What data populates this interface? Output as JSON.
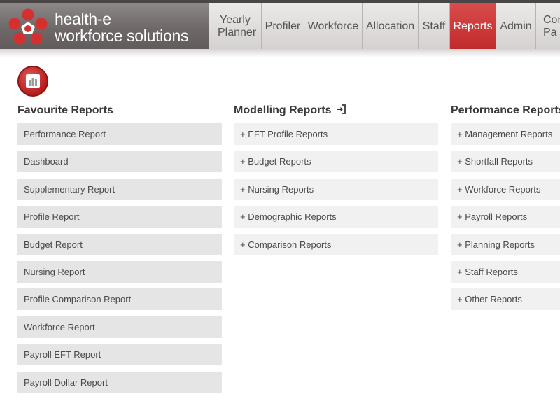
{
  "brand": {
    "line1": "health-e",
    "line2": "workforce solutions",
    "accent": "#c12a2b"
  },
  "nav": {
    "items": [
      {
        "label": "Yearly Planner"
      },
      {
        "label": "Profiler"
      },
      {
        "label": "Workforce"
      },
      {
        "label": "Allocation"
      },
      {
        "label": "Staff"
      },
      {
        "label": "Reports",
        "active": true
      },
      {
        "label": "Admin"
      },
      {
        "label": "Con Pa"
      }
    ]
  },
  "favourites": {
    "title": "Favourite Reports",
    "items": [
      "Performance Report",
      "Dashboard",
      "Supplementary Report",
      "Profile Report",
      "Budget Report",
      "Nursing Report",
      "Profile Comparison Report",
      "Workforce Report",
      "Payroll EFT Report",
      "Payroll Dollar Report"
    ]
  },
  "modelling": {
    "title": "Modelling Reports",
    "title_icon": "enter-icon",
    "items": [
      "+ EFT Profile Reports",
      "+ Budget Reports",
      "+ Nursing Reports",
      "+ Demographic Reports",
      "+ Comparison Reports"
    ]
  },
  "performance": {
    "title": "Performance Reports",
    "items": [
      "+ Management Reports",
      "+ Shortfall Reports",
      "+ Workforce Reports",
      "+ Payroll Reports",
      "+ Planning Reports",
      "+ Staff Reports",
      "+ Other Reports"
    ]
  }
}
